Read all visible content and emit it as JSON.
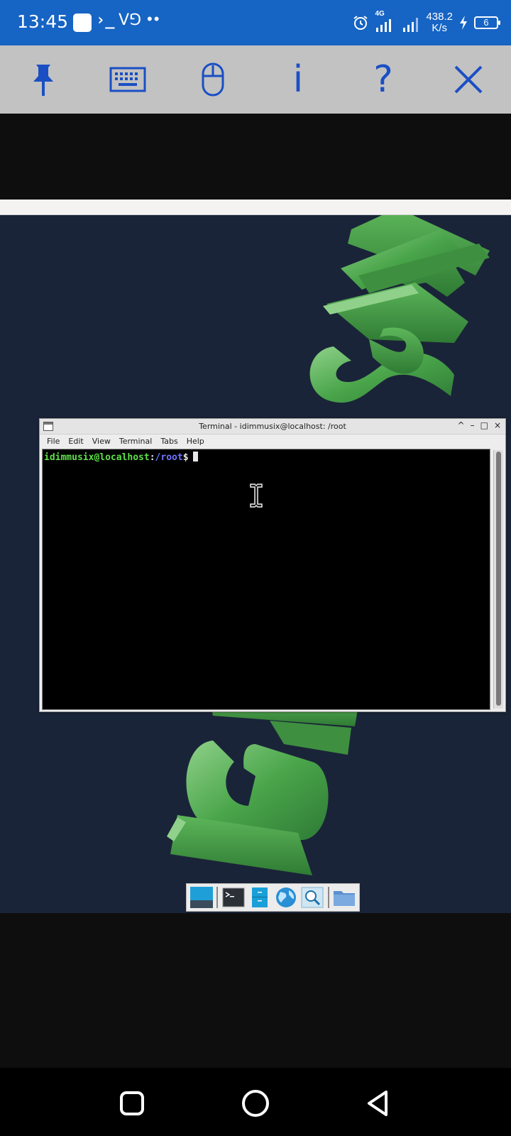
{
  "status_bar": {
    "time": "13:45",
    "terminal_glyph": "›_",
    "vnc_glyph": "V⅁",
    "dots": "••",
    "network_type": "4G",
    "speed_value": "438.2",
    "speed_unit": "K/s",
    "battery_level": "6"
  },
  "vnc_toolbar": {
    "icons": [
      "pin-icon",
      "keyboard-icon",
      "mouse-icon",
      "info-icon",
      "help-icon",
      "close-icon"
    ],
    "info_label": "i",
    "help_label": "?"
  },
  "terminal": {
    "title": "Terminal - idimmusix@localhost: /root",
    "controls": [
      "^",
      "–",
      "□",
      "×"
    ],
    "menu": [
      "File",
      "Edit",
      "View",
      "Terminal",
      "Tabs",
      "Help"
    ],
    "prompt_user_host": "idimmusix@localhost",
    "prompt_colon": ":",
    "prompt_path": "/root",
    "prompt_symbol": "$"
  },
  "dock": {
    "items": [
      "desktop-icon",
      "terminal-icon",
      "file-manager-icon",
      "web-browser-icon",
      "app-finder-icon",
      "folder-icon"
    ]
  },
  "wallpaper": {
    "glyphs": "xfce-like green 3D letters"
  },
  "colors": {
    "status_bar": "#1664c4",
    "toolbar": "#c2c2c2",
    "toolbar_icon": "#1a4fc4",
    "desktop": "#1a2438",
    "prompt_user": "#5ee04a",
    "prompt_path": "#6f73ff"
  }
}
